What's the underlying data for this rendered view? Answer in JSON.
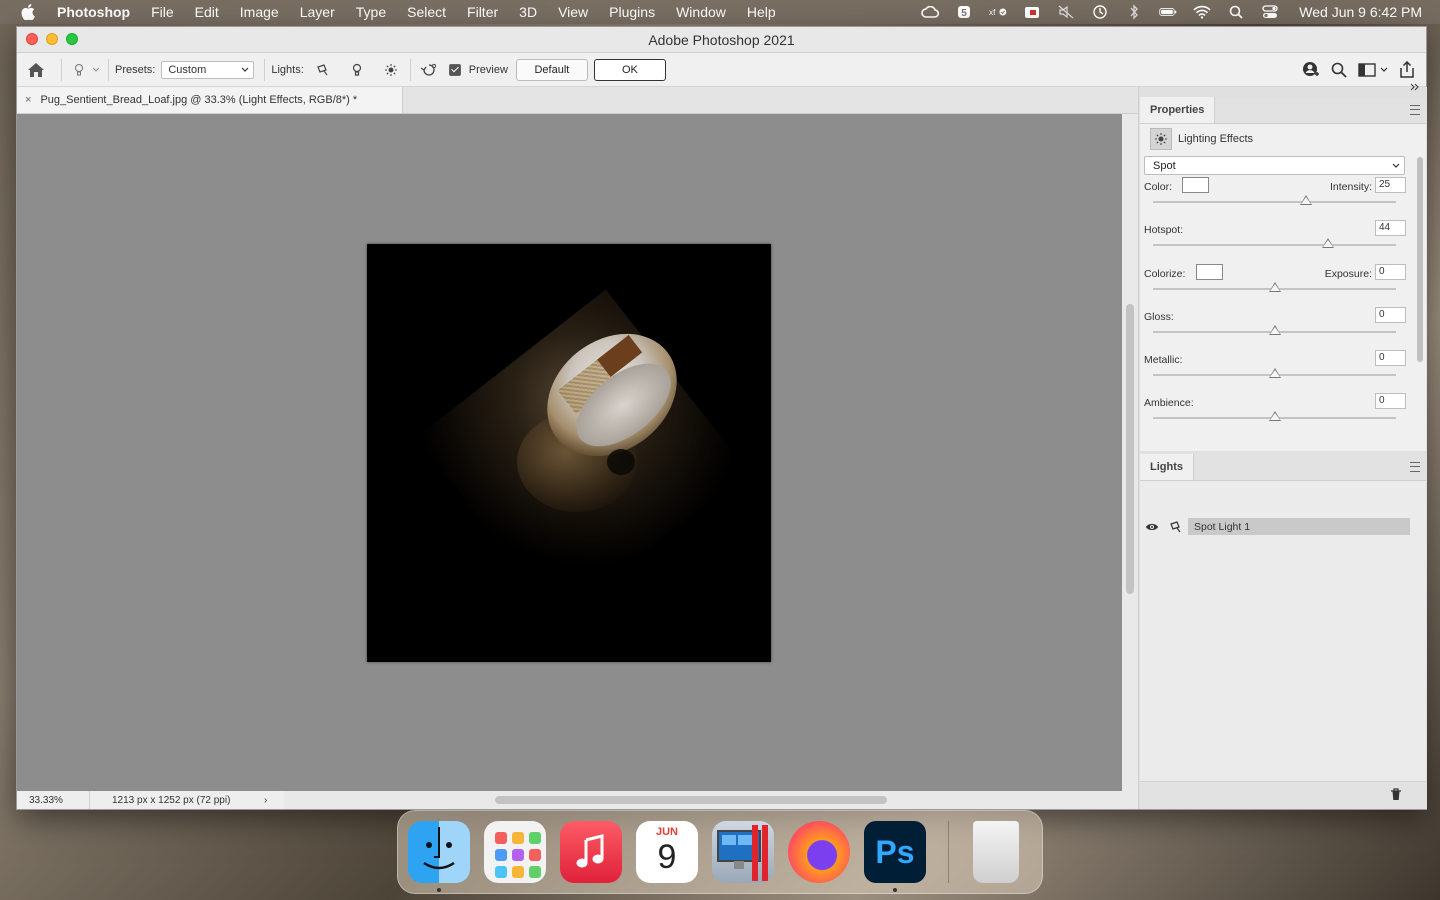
{
  "menubar": {
    "app_name": "Photoshop",
    "items": [
      "File",
      "Edit",
      "Image",
      "Layer",
      "Type",
      "Select",
      "Filter",
      "3D",
      "View",
      "Plugins",
      "Window",
      "Help"
    ],
    "clock": "Wed Jun 9  6:42 PM",
    "status_icons": [
      "creative-cloud-icon",
      "5-badge-icon",
      "xf-icon",
      "photo-icon",
      "mute-icon",
      "time-machine-icon",
      "bluetooth-icon",
      "battery-icon",
      "wifi-icon",
      "spotlight-icon",
      "control-center-icon"
    ]
  },
  "window": {
    "title": "Adobe Photoshop 2021"
  },
  "options_bar": {
    "presets_label": "Presets:",
    "presets_value": "Custom",
    "lights_label": "Lights:",
    "preview_label": "Preview",
    "default_label": "Default",
    "ok_label": "OK"
  },
  "document": {
    "tab_title": "Pug_Sentient_Bread_Loaf.jpg @ 33.3% (Light Effects, RGB/8*) *",
    "close_glyph": "×",
    "zoom": "33.33%",
    "dimensions": "1213 px x 1252 px (72 ppi)",
    "status_arrow": "›"
  },
  "properties_panel": {
    "tab_label": "Properties",
    "header_label": "Lighting Effects",
    "light_type": "Spot",
    "color_label": "Color:",
    "intensity_label": "Intensity:",
    "intensity_value": "25",
    "hotspot_label": "Hotspot:",
    "hotspot_value": "44",
    "colorize_label": "Colorize:",
    "exposure_label": "Exposure:",
    "exposure_value": "0",
    "gloss_label": "Gloss:",
    "gloss_value": "0",
    "metallic_label": "Metallic:",
    "metallic_value": "0",
    "ambience_label": "Ambience:",
    "ambience_value": "0",
    "slider_levels": {
      "intensity": 0.63,
      "hotspot": 0.72,
      "exposure": 0.5,
      "gloss": 0.5,
      "metallic": 0.5,
      "ambience": 0.5
    }
  },
  "lights_panel": {
    "tab_label": "Lights",
    "lights": [
      "Spot Light 1"
    ]
  },
  "dock": {
    "apps": [
      "Finder",
      "Launchpad",
      "Music",
      "Calendar",
      "Parallels",
      "Firefox",
      "Photoshop",
      "Trash"
    ],
    "calendar_month": "JUN",
    "calendar_day": "9",
    "photoshop_label": "Ps"
  }
}
